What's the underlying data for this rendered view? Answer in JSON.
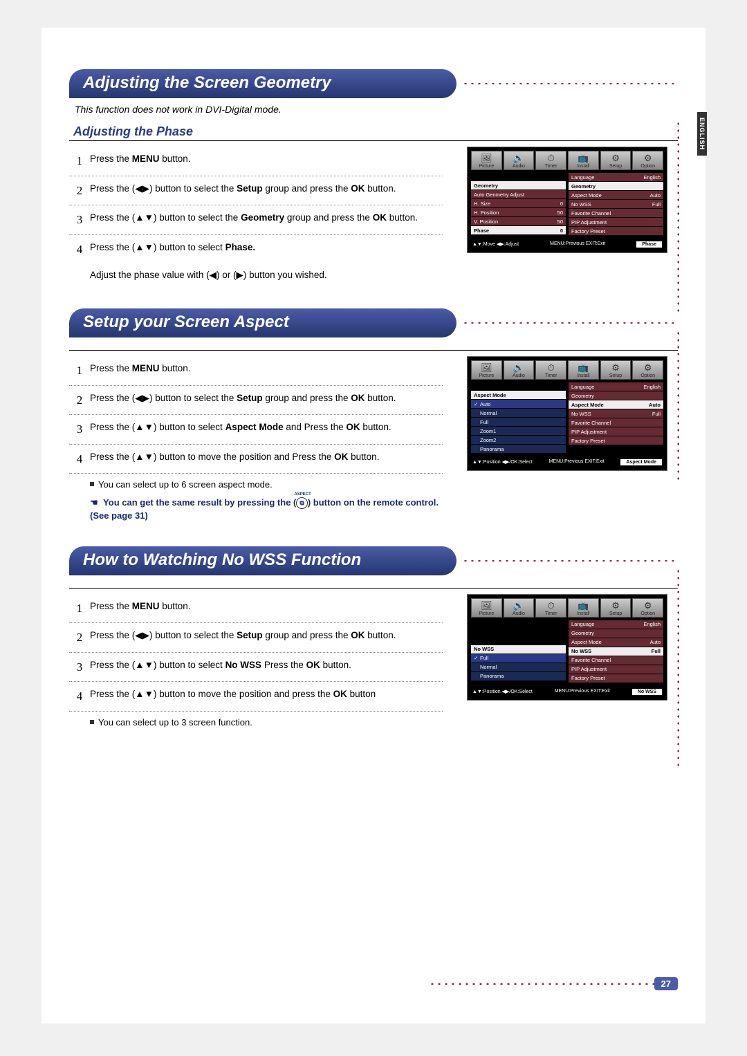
{
  "lang_tab": "ENGLISH",
  "page_number": "27",
  "section1": {
    "title": "Adjusting the Screen Geometry",
    "note": "This function does not work in DVI-Digital mode.",
    "subheading": "Adjusting the Phase",
    "step1_n": "1",
    "step1": "Press the MENU button.",
    "step2_n": "2",
    "step2": "Press the (◀▶) button to select the Setup group and press the OK button.",
    "step3_n": "3",
    "step3": "Press the (▲▼) button to select the Geometry group and press the OK button.",
    "step4_n": "4",
    "step4a": "Press the (▲▼) button to select Phase.",
    "step4b": "Adjust the phase value with (◀) or (▶) button you wished.",
    "osd": {
      "tabs": [
        "Picture",
        "Audio",
        "Timer",
        "Install",
        "Setup",
        "Option"
      ],
      "left_header": "Geometry",
      "left_items": [
        {
          "l": "Auto Geometry Adjust",
          "v": ""
        },
        {
          "l": "H. Size",
          "v": "0"
        },
        {
          "l": "H. Position",
          "v": "50"
        },
        {
          "l": "V. Position",
          "v": "50"
        },
        {
          "l": "Phase",
          "v": "0"
        }
      ],
      "right_items": [
        {
          "l": "Language",
          "v": "English"
        },
        {
          "l": "Geometry",
          "v": ""
        },
        {
          "l": "Aspect Mode",
          "v": "Auto"
        },
        {
          "l": "No WSS",
          "v": "Full"
        },
        {
          "l": "Favorite Channel",
          "v": ""
        },
        {
          "l": "PIP Adjustment",
          "v": ""
        },
        {
          "l": "Factory Preset",
          "v": ""
        }
      ],
      "foot_l": "▲▼:Move  ◀▶:Adjust",
      "foot_m": "MENU:Previous  EXIT:Exit",
      "foot_r": "Phase"
    }
  },
  "section2": {
    "title": "Setup your Screen Aspect",
    "step1_n": "1",
    "step1": "Press the MENU button.",
    "step2_n": "2",
    "step2": "Press the (◀▶) button to select the Setup group and press the OK button.",
    "step3_n": "3",
    "step3": "Press the (▲▼) button to select Aspect Mode and Press the OK button.",
    "step4_n": "4",
    "step4": "Press the (▲▼) button to move the position and Press the OK button.",
    "note1": "You can select up to 6 screen aspect mode.",
    "note2a": "You can get the same result by pressing the (",
    "note2b": ") button on the remote control. (See page 31)",
    "aspect_icon": "⧉",
    "osd": {
      "tabs": [
        "Picture",
        "Audio",
        "Timer",
        "Install",
        "Setup",
        "Option"
      ],
      "left_header": "Aspect Mode",
      "left_items": [
        {
          "l": "Auto",
          "chk": true
        },
        {
          "l": "Normal"
        },
        {
          "l": "Full"
        },
        {
          "l": "Zoom1"
        },
        {
          "l": "Zoom2"
        },
        {
          "l": "Panorama"
        }
      ],
      "right_items": [
        {
          "l": "Language",
          "v": "English"
        },
        {
          "l": "Geometry",
          "v": ""
        },
        {
          "l": "Aspect Mode",
          "v": "Auto"
        },
        {
          "l": "No WSS",
          "v": "Full"
        },
        {
          "l": "Favorite Channel",
          "v": ""
        },
        {
          "l": "PIP Adjustment",
          "v": ""
        },
        {
          "l": "Factory Preset",
          "v": ""
        }
      ],
      "foot_l": "▲▼:Position ◀▶/OK:Select",
      "foot_m": "MENU:Previous  EXIT:Exit",
      "foot_r": "Aspect Mode"
    }
  },
  "section3": {
    "title": "How to Watching No WSS Function",
    "step1_n": "1",
    "step1": "Press the MENU button.",
    "step2_n": "2",
    "step2": "Press the (◀▶) button to select the Setup group and press the OK button.",
    "step3_n": "3",
    "step3": "Press the (▲▼) button to select No WSS Press the OK button.",
    "step4_n": "4",
    "step4": "Press the (▲▼) button to move the position and press the OK button",
    "note1": "You can select up to 3 screen function.",
    "osd": {
      "tabs": [
        "Picture",
        "Audio",
        "Timer",
        "Install",
        "Setup",
        "Option"
      ],
      "left_header": "No WSS",
      "left_items": [
        {
          "l": "Full",
          "chk": true
        },
        {
          "l": "Normal"
        },
        {
          "l": "Panorama"
        }
      ],
      "right_items": [
        {
          "l": "Language",
          "v": "English"
        },
        {
          "l": "Geometry",
          "v": ""
        },
        {
          "l": "Aspect Mode",
          "v": "Auto"
        },
        {
          "l": "No WSS",
          "v": "Full"
        },
        {
          "l": "Favorite Channel",
          "v": ""
        },
        {
          "l": "PIP Adjustment",
          "v": ""
        },
        {
          "l": "Factory Preset",
          "v": ""
        }
      ],
      "foot_l": "▲▼:Position ◀▶/OK:Select",
      "foot_m": "MENU:Previous  EXIT:Exit",
      "foot_r": "No WSS"
    }
  }
}
